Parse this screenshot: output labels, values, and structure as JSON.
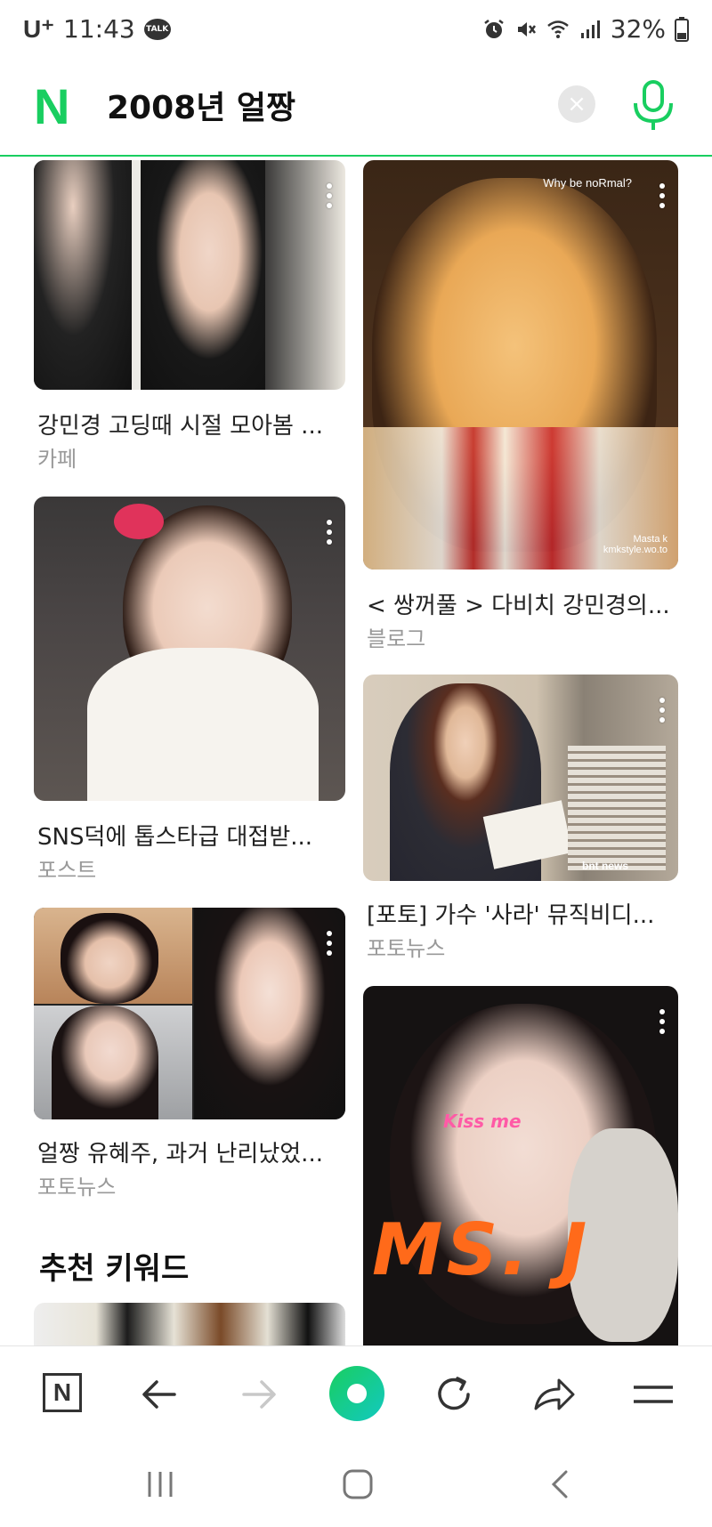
{
  "status_bar": {
    "carrier": "U⁺",
    "time": "11:43",
    "talk_badge": "TALK",
    "battery": "32%"
  },
  "search": {
    "logo": "N",
    "query": "2008년 얼짱",
    "clear_label": "×"
  },
  "results_left": [
    {
      "title": "강민경 고딩때 시절 모아봄 ...",
      "source": "카페"
    },
    {
      "title": "SNS덕에 톱스타급 대접받...",
      "source": "포스트"
    },
    {
      "title": "얼짱 유혜주, 과거 난리났었...",
      "source": "포토뉴스"
    }
  ],
  "results_right": [
    {
      "title": "< 쌍꺼풀 > 다비치 강민경의...",
      "source": "블로그",
      "overlay_text": "Why be noRmal?",
      "overlay_credit": "Masta k\nkmkstyle.wo.to"
    },
    {
      "title": "[포토] 가수 '사라' 뮤직비디...",
      "source": "포토뉴스",
      "overlay_text": "bnt news"
    },
    {
      "title": "",
      "source": "",
      "overlay_text": "Kiss me",
      "overlay_big": "MS. J"
    }
  ],
  "recommended_title": "추천 키워드",
  "toolbar": {
    "home_label": "N"
  },
  "colors": {
    "brand_green": "#19ce60",
    "divider": "#19ce60"
  }
}
